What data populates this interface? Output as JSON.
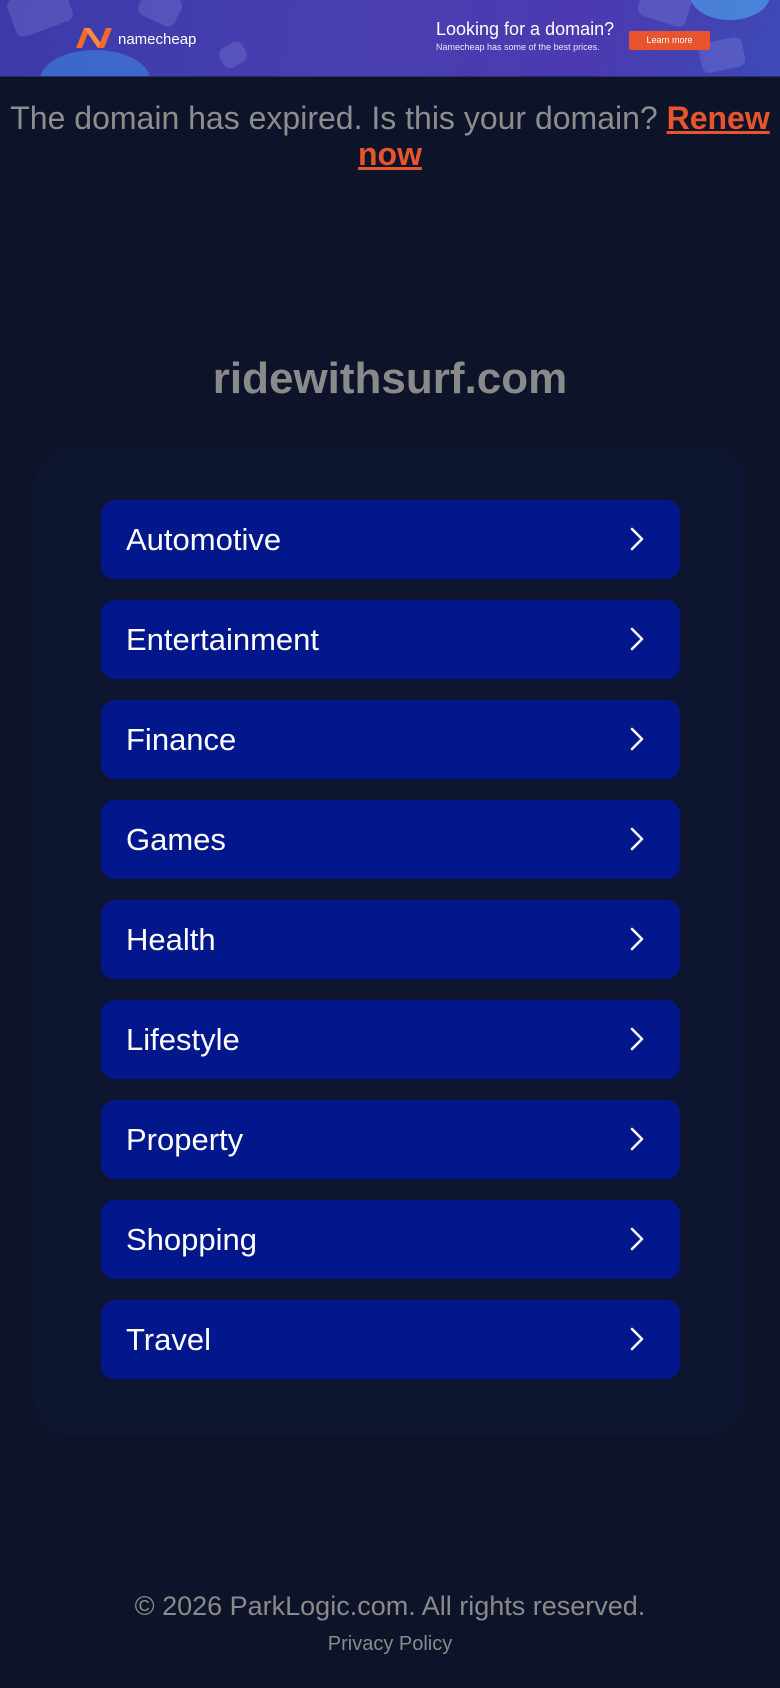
{
  "banner": {
    "brand": "namecheap",
    "title": "Looking for a domain?",
    "subtitle": "Namecheap has some of the best prices.",
    "button_label": "Learn more",
    "button_color": "#e8542d"
  },
  "notice": {
    "text": "The domain has expired. Is this your domain?",
    "renew_label": "Renew now",
    "accent_color": "#e8542d"
  },
  "domain": "ridewithsurf.com",
  "categories": [
    {
      "label": "Automotive",
      "icon": "chevron-right-icon"
    },
    {
      "label": "Entertainment",
      "icon": "chevron-right-icon"
    },
    {
      "label": "Finance",
      "icon": "chevron-right-icon"
    },
    {
      "label": "Games",
      "icon": "chevron-right-icon"
    },
    {
      "label": "Health",
      "icon": "chevron-right-icon"
    },
    {
      "label": "Lifestyle",
      "icon": "chevron-right-icon"
    },
    {
      "label": "Property",
      "icon": "chevron-right-icon"
    },
    {
      "label": "Shopping",
      "icon": "chevron-right-icon"
    },
    {
      "label": "Travel",
      "icon": "chevron-right-icon"
    }
  ],
  "footer": {
    "copyright": "© 2026 ParkLogic.com. All rights reserved.",
    "privacy_label": "Privacy Policy"
  },
  "colors": {
    "background": "#0d1429",
    "category_button": "#03178c",
    "text_muted": "#8a8a8a"
  }
}
